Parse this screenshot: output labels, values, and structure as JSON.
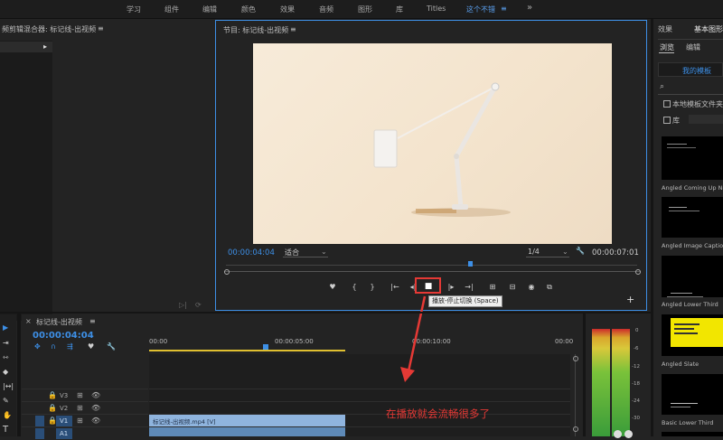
{
  "menu": {
    "items": [
      "学习",
      "组件",
      "编辑",
      "颜色",
      "效果",
      "音频",
      "图形",
      "库",
      "Titles",
      "这个不错"
    ],
    "more": "»",
    "active_menu_icon": "≡"
  },
  "source_panel": {
    "title": "频剪辑混合器: 标记线-出视频",
    "menu_icon": "≡",
    "arrow": "▸"
  },
  "program": {
    "title": "节目: 标记线-出视频",
    "menu_icon": "≡",
    "timecode_current": "00:00:04:04",
    "fit_label": "适合",
    "resolution": "1/4",
    "timecode_total": "00:00:07:01",
    "tooltip": "播放-停止切换 (Space)",
    "add": "+"
  },
  "timeline": {
    "title": "标记线-出视频",
    "menu_icon": "≡",
    "close": "×",
    "timecode": "00:00:04:04",
    "ruler": [
      "00:00",
      "00:00:05:00",
      "00:00:10:00",
      "00:00"
    ],
    "tracks": [
      "V3",
      "V2",
      "V1",
      "A1"
    ],
    "clip_label": "标记线-出视频.mp4 [V]",
    "annotation": "在播放就会流畅很多了"
  },
  "meter": {
    "scale": [
      "0",
      "-6",
      "-12",
      "-18",
      "-24",
      "-30"
    ]
  },
  "right_panel": {
    "tab_effects": "效果",
    "tab_graphics": "基本图形",
    "sub_browse": "浏览",
    "sub_edit": "编辑",
    "my_templates": "我的模板",
    "search_icon": "⌕",
    "local_templates": "本地模板文件夹",
    "library": "库",
    "items": [
      "Angled Coming Up Next",
      "Angled Image Caption",
      "Angled Lower Third",
      "Angled Slate",
      "Basic Lower Third"
    ]
  },
  "colors": {
    "accent": "#3d8fe6",
    "annotation": "#e53935",
    "clip": "#8fb4de"
  }
}
